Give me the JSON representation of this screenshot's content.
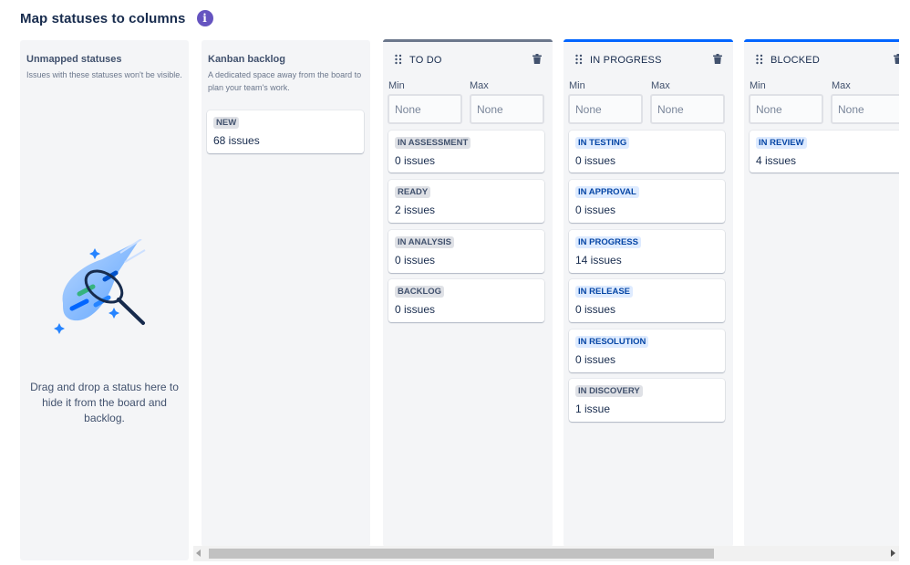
{
  "header": {
    "title": "Map statuses to columns",
    "info_icon": "info-icon"
  },
  "unmapped": {
    "title": "Unmapped statuses",
    "description": "Issues with these statuses won't be visible.",
    "drop_text": "Drag and drop a status here to hide it from the board and backlog."
  },
  "kanban": {
    "title": "Kanban backlog",
    "description": "A dedicated space away from the board to plan your team's work.",
    "statuses": [
      {
        "name": "NEW",
        "count": "68 issues"
      }
    ]
  },
  "columns": [
    {
      "name": "TO DO",
      "min_label": "Min",
      "max_label": "Max",
      "min_placeholder": "None",
      "max_placeholder": "None",
      "statuses": [
        {
          "name": "IN ASSESSMENT",
          "count": "0 issues"
        },
        {
          "name": "READY",
          "count": "2 issues"
        },
        {
          "name": "IN ANALYSIS",
          "count": "0 issues"
        },
        {
          "name": "BACKLOG",
          "count": "0 issues"
        }
      ]
    },
    {
      "name": "IN PROGRESS",
      "min_label": "Min",
      "max_label": "Max",
      "min_placeholder": "None",
      "max_placeholder": "None",
      "statuses": [
        {
          "name": "IN TESTING",
          "count": "0 issues"
        },
        {
          "name": "IN APPROVAL",
          "count": "0 issues"
        },
        {
          "name": "IN PROGRESS",
          "count": "14 issues"
        },
        {
          "name": "IN RELEASE",
          "count": "0 issues"
        },
        {
          "name": "IN RESOLUTION",
          "count": "0 issues"
        },
        {
          "name": "IN DISCOVERY",
          "count": "1 issue"
        }
      ]
    },
    {
      "name": "BLOCKED",
      "min_label": "Min",
      "max_label": "Max",
      "min_placeholder": "None",
      "max_placeholder": "None",
      "statuses": [
        {
          "name": "IN REVIEW",
          "count": "4 issues"
        }
      ]
    }
  ],
  "colors": {
    "info_icon": "#6554c0",
    "todo_top_border": "#6b778c",
    "in_progress_top_border": "#0065ff",
    "lozenge_grey": "#dfe1e6",
    "lozenge_blue": "#deebff"
  }
}
